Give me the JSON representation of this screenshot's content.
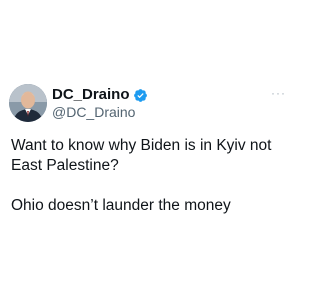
{
  "tweet": {
    "display_name": "DC_Draino",
    "handle": "@DC_Draino",
    "verified": true,
    "more_icon": "ellipsis-icon",
    "text_paragraph_1": "Want to know why Biden is in Kyiv not East Palestine?",
    "text_paragraph_2": "Ohio doesn’t launder the money"
  },
  "colors": {
    "verified_badge": "#1d9bf0",
    "text": "#0f1419",
    "secondary_text": "#536471"
  }
}
